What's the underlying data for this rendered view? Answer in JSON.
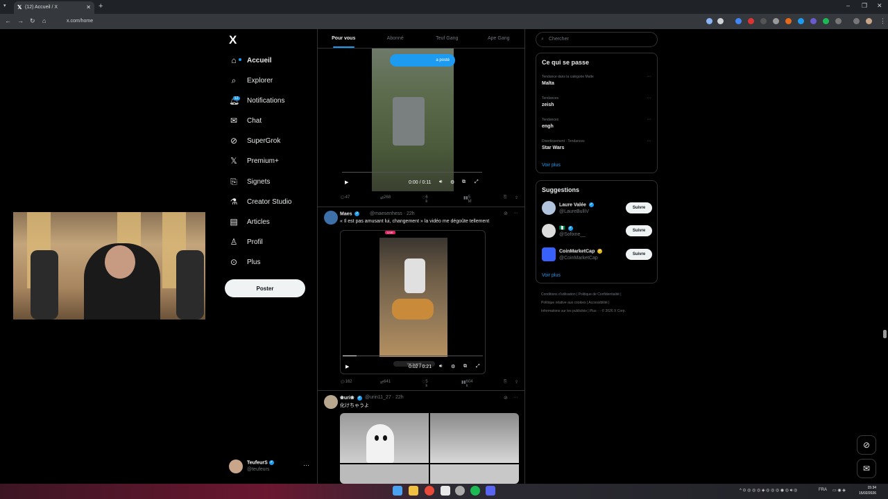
{
  "browser": {
    "tab_title": "(12) Accueil / X",
    "url": "x.com/home",
    "window_controls": [
      "–",
      "❐",
      "✕"
    ]
  },
  "nav": {
    "brand": "X",
    "items": [
      {
        "label": "Accueil",
        "icon": "home-icon",
        "active": true
      },
      {
        "label": "Explorer",
        "icon": "search-icon"
      },
      {
        "label": "Notifications",
        "icon": "bell-icon",
        "badge": "12"
      },
      {
        "label": "Chat",
        "icon": "mail-icon"
      },
      {
        "label": "SuperGrok",
        "icon": "grok-icon"
      },
      {
        "label": "Premium+",
        "icon": "x-icon"
      },
      {
        "label": "Signets",
        "icon": "bookmark-icon"
      },
      {
        "label": "Creator Studio",
        "icon": "flask-icon"
      },
      {
        "label": "Articles",
        "icon": "article-icon"
      },
      {
        "label": "Profil",
        "icon": "person-icon"
      },
      {
        "label": "Plus",
        "icon": "more-circle-icon"
      }
    ],
    "post_button": "Poster",
    "account": {
      "name": "TeufeurS",
      "handle": "@teufeurs",
      "more": "···"
    }
  },
  "feed": {
    "tabs": [
      "Pour vous",
      "Abonné",
      "Teuf Gang",
      "Ape Gang"
    ],
    "tweet1": {
      "posted_label": "a posté",
      "time": "0:00 / 0:11",
      "progress": 0.0,
      "stats": {
        "replies": "47",
        "reposts": "268",
        "likes": "6 k",
        "views": "5 M"
      }
    },
    "tweet2": {
      "name": "Maes",
      "handle": "@maesenhess · 22h",
      "text": "« Il est pas amusant lui, changement » la vidéo me dégoûte tellement",
      "time": "0:02 / 0:21",
      "progress": 0.1,
      "live_label": "LIVE",
      "overlay_label": "Voir le profil",
      "stats": {
        "replies": "162",
        "reposts": "641",
        "likes": "5 k",
        "views": "604 k"
      }
    },
    "tweet3": {
      "name": "❀uri❀",
      "handle": "@urin11_27 · 22h",
      "text": "化けちゃうよ"
    }
  },
  "sidebar": {
    "search_placeholder": "Chercher",
    "trends_title": "Ce qui se passe",
    "trends": [
      {
        "category": "Tendance dans la catégorie Malte",
        "name": "Malta"
      },
      {
        "category": "Tendances",
        "name": "zeish"
      },
      {
        "category": "Tendances",
        "name": "engh"
      },
      {
        "category": "Divertissement · Tendances",
        "name": "Star Wars"
      }
    ],
    "trends_more": "Voir plus",
    "suggestions_title": "Suggestions",
    "suggestions": [
      {
        "name": "Laure Valée",
        "handle": "@LaureBulliV",
        "button": "Suivre",
        "verified": "blue"
      },
      {
        "name": "🇳🇬",
        "handle": "@Sofixne__",
        "button": "Suivre",
        "verified": "blue"
      },
      {
        "name": "CoinMarketCap",
        "handle": "@CoinMarketCap",
        "button": "Suivre",
        "verified": "gold"
      }
    ],
    "suggestions_more": "Voir plus",
    "footer": {
      "line1": "Conditions d'utilisation  |  Politique de Confidentialité  |",
      "line2": "Politique relative aux cookies  |  Accessibilité  |",
      "line3": "Informations sur les publicités  |  Plus ···  © 2026 X Corp."
    }
  },
  "taskbar": {
    "lang": "FRA",
    "time": "15:34",
    "date": "15/02/2026"
  }
}
